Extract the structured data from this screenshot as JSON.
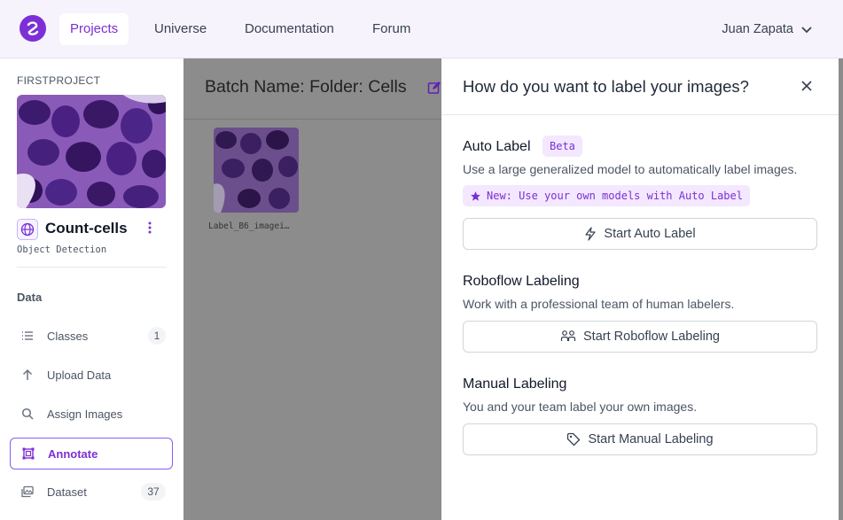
{
  "nav": {
    "links": [
      "Projects",
      "Universe",
      "Documentation",
      "Forum"
    ],
    "active": "Projects",
    "user_name": "Juan Zapata"
  },
  "sidebar": {
    "workspace_label": "FIRSTPROJECT",
    "project_title": "Count-cells",
    "project_type": "Object Detection",
    "section_label": "Data",
    "items": [
      {
        "label": "Classes",
        "badge": "1",
        "icon": "list-icon"
      },
      {
        "label": "Upload Data",
        "badge": "",
        "icon": "arrow-up-icon"
      },
      {
        "label": "Assign Images",
        "badge": "",
        "icon": "search-icon"
      },
      {
        "label": "Annotate",
        "badge": "",
        "icon": "annotate-icon",
        "active": true
      },
      {
        "label": "Dataset",
        "badge": "37",
        "icon": "images-icon"
      }
    ]
  },
  "main": {
    "batch_title": "Batch Name: Folder: Cells",
    "image_name": "Label_B6_imagei…"
  },
  "drawer": {
    "title": "How do you want to label your images?",
    "auto": {
      "title": "Auto Label",
      "badge": "Beta",
      "desc": "Use a large generalized model to automatically label images.",
      "new_note": "New: Use your own models with Auto Label",
      "button": "Start Auto Label"
    },
    "roboflow": {
      "title": "Roboflow Labeling",
      "desc": "Work with a professional team of human labelers.",
      "button": "Start Roboflow Labeling"
    },
    "manual": {
      "title": "Manual Labeling",
      "desc": "You and your team label your own images.",
      "button": "Start Manual Labeling"
    }
  },
  "colors": {
    "accent": "#7c2fd6",
    "overlay": "#8c8c8c"
  }
}
